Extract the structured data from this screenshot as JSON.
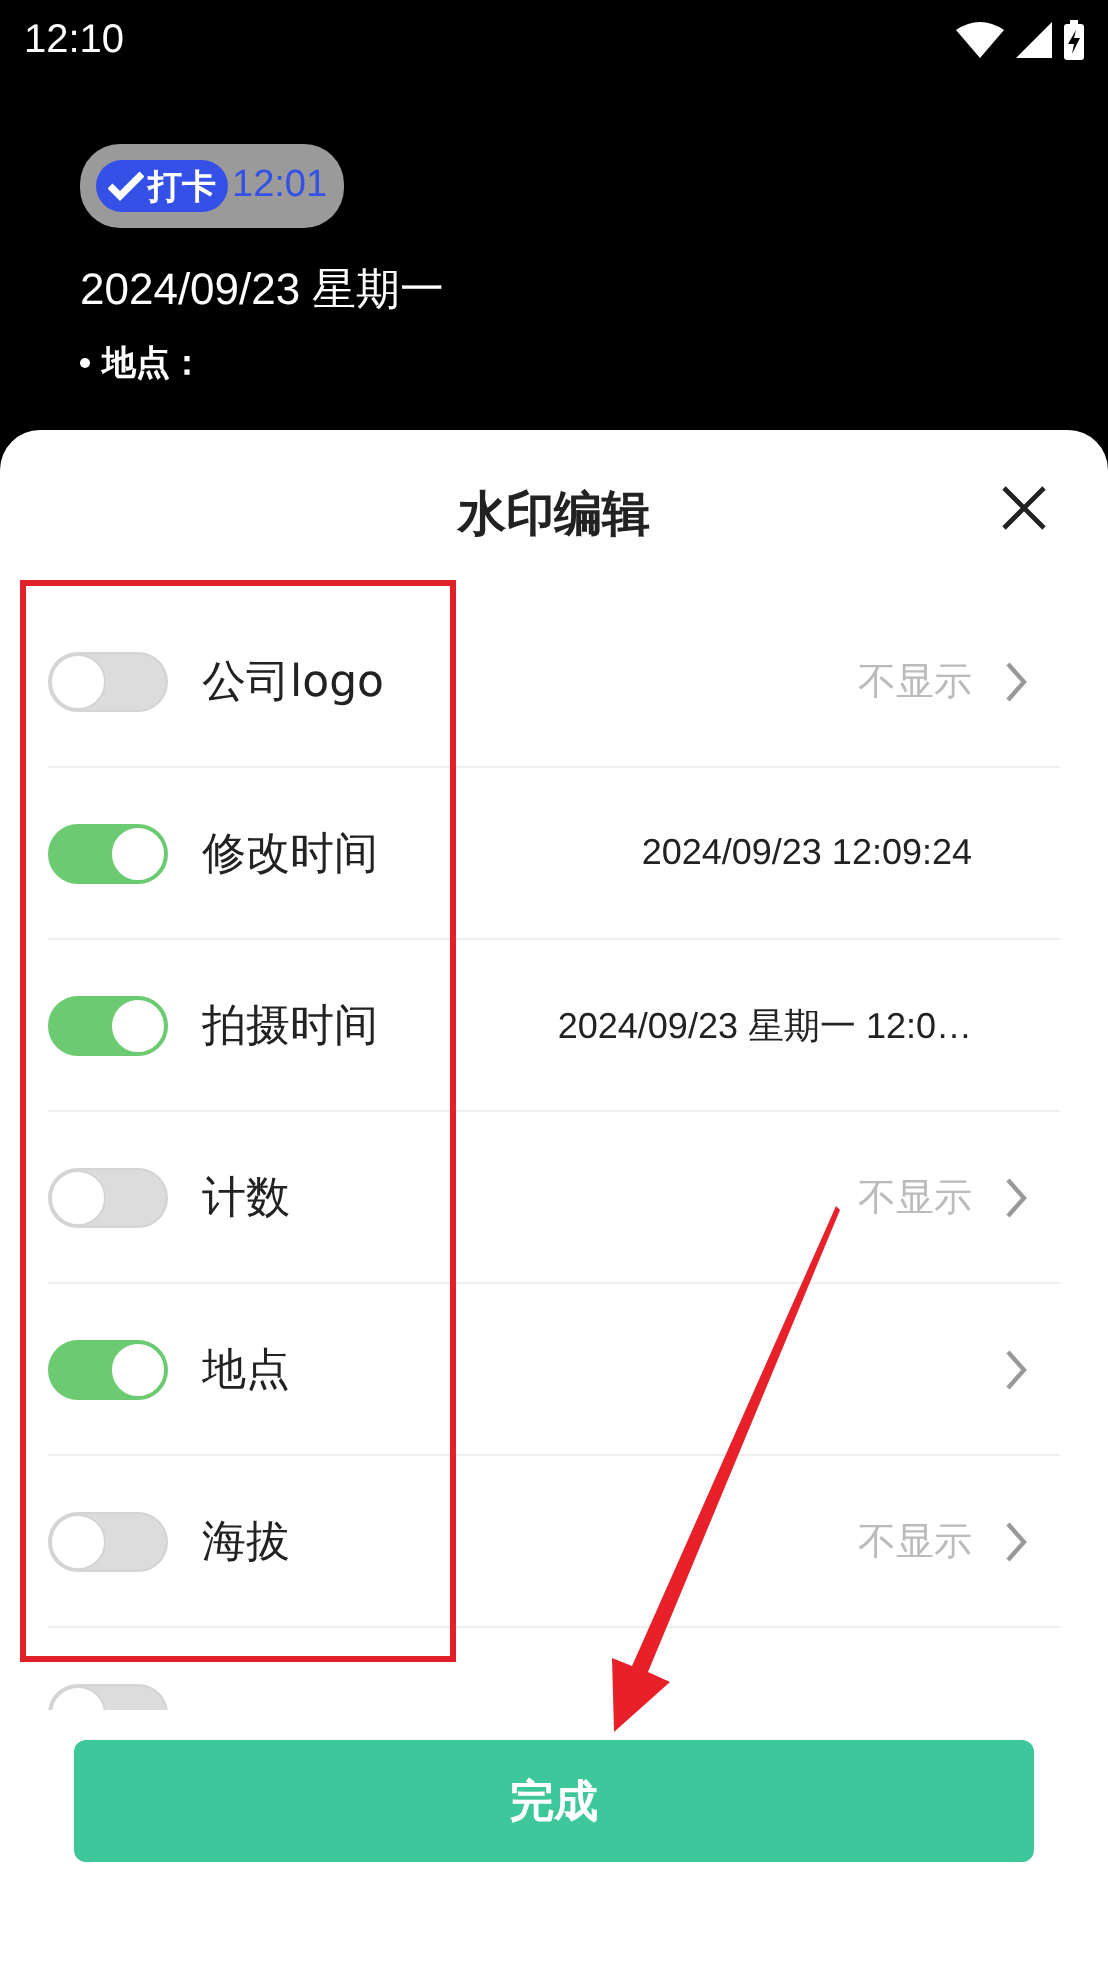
{
  "status_bar": {
    "time": "12:10"
  },
  "preview": {
    "badge": {
      "label": "打卡",
      "time": "12:01"
    },
    "date": "2024/09/23 星期一",
    "bullets": [
      "地点："
    ]
  },
  "sheet": {
    "title": "水印编辑",
    "rows": [
      {
        "label": "公司logo",
        "on": false,
        "value": "不显示",
        "kind": "hint",
        "chevron": true
      },
      {
        "label": "修改时间",
        "on": true,
        "value": "2024/09/23 12:09:24",
        "kind": "text",
        "chevron": false
      },
      {
        "label": "拍摄时间",
        "on": true,
        "value": "2024/09/23 星期一 12:0…",
        "kind": "text",
        "chevron": false
      },
      {
        "label": "计数",
        "on": false,
        "value": "不显示",
        "kind": "hint",
        "chevron": true
      },
      {
        "label": "地点",
        "on": true,
        "chevron": true
      },
      {
        "label": "海拔",
        "on": false,
        "value": "不显示",
        "kind": "hint",
        "chevron": true
      },
      {
        "on": false
      }
    ],
    "done_button": "完成"
  },
  "annotation": {
    "frame": true,
    "arrow": true
  }
}
